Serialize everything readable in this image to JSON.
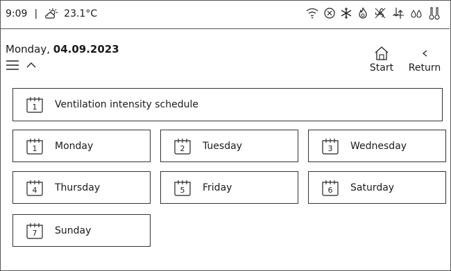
{
  "status": {
    "time": "9:09",
    "separator": "|",
    "temperature": "23.1°C",
    "icons": [
      "weather-partly-sunny-icon",
      "wifi-icon",
      "stop-circle-icon",
      "snowflake-icon",
      "flame-icon",
      "fan-off-icon",
      "ventilation-arrows-icon",
      "water-drops-icon",
      "thermometers-icon"
    ]
  },
  "header": {
    "day": "Monday,",
    "date": "04.09.2023"
  },
  "nav": {
    "start_label": "Start",
    "return_label": "Return"
  },
  "schedule": {
    "badge": "1",
    "label": "Ventilation intensity schedule"
  },
  "days": [
    {
      "badge": "1",
      "label": "Monday"
    },
    {
      "badge": "2",
      "label": "Tuesday"
    },
    {
      "badge": "3",
      "label": "Wednesday"
    },
    {
      "badge": "4",
      "label": "Thursday"
    },
    {
      "badge": "5",
      "label": "Friday"
    },
    {
      "badge": "6",
      "label": "Saturday"
    },
    {
      "badge": "7",
      "label": "Sunday"
    }
  ]
}
